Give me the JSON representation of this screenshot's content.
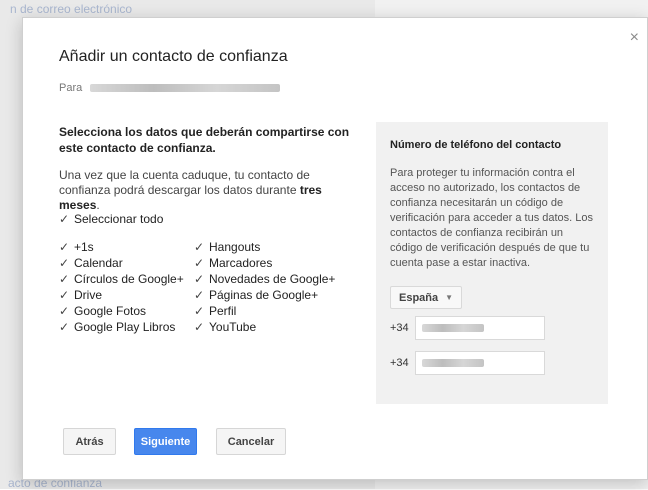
{
  "dialog": {
    "title": "Añadir un contacto de confianza",
    "to_label": "Para",
    "close_glyph": "×",
    "lead": "Selecciona los datos que deberán compartirse con este contacto de confianza.",
    "info_prefix": "Una vez que la cuenta caduque, tu contacto de confianza podrá descargar los datos durante",
    "info_bold": "tres meses",
    "info_suffix": ".",
    "select_all": "Seleccionar todo",
    "services_left": [
      "+1s",
      "Calendar",
      "Círculos de Google+",
      "Drive",
      "Google Fotos",
      "Google Play Libros"
    ],
    "services_right": [
      "Hangouts",
      "Marcadores",
      "Novedades de Google+",
      "Páginas de Google+",
      "Perfil",
      "YouTube"
    ],
    "buttons": {
      "back": "Atrás",
      "next": "Siguiente",
      "cancel": "Cancelar"
    }
  },
  "phone_panel": {
    "title": "Número de teléfono del contacto",
    "text": "Para proteger tu información contra el acceso no autorizado, los contactos de confianza necesitarán un código de verificación para acceder a tus datos. Los contactos de confianza recibirán un código de verificación después de que tu cuenta pase a estar inactiva.",
    "country": "España",
    "prefix_1": "+34",
    "prefix_2": "+34"
  },
  "background": {
    "top_link": "n de correo electrónico",
    "bottom_link": "acto de confianza"
  },
  "colors": {
    "primary_button": "#4787ed",
    "panel_bg": "#f1f1f1"
  },
  "icons": {
    "close": "close-icon",
    "check": "checkmark-icon",
    "caret": "chevron-down-icon"
  }
}
